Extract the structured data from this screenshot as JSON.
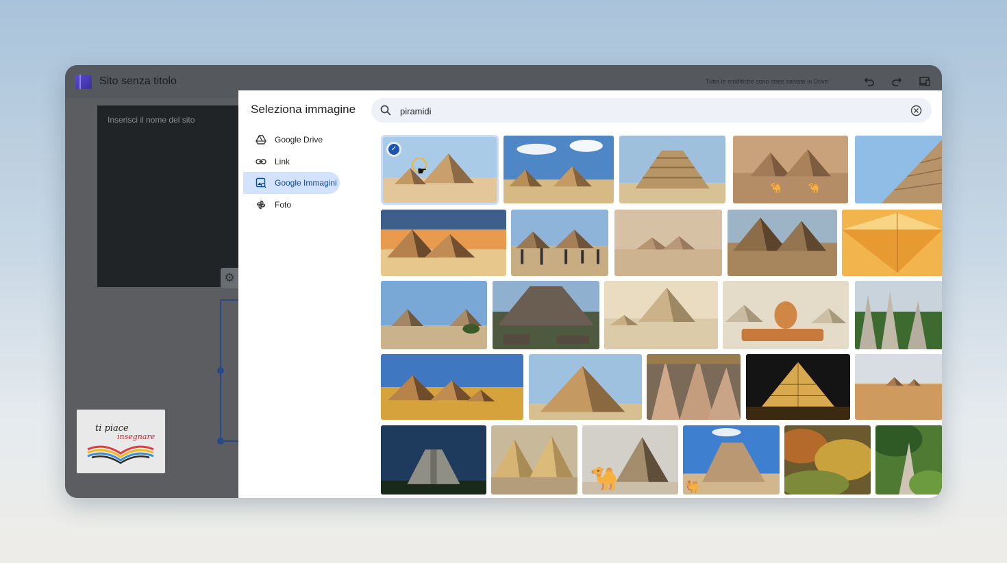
{
  "app": {
    "title": "Sito senza titolo",
    "saved_status": "Tutte le modifiche sono state salvate in Drive",
    "toolbar_icons": [
      "undo-icon",
      "redo-icon",
      "preview-devices-icon"
    ]
  },
  "editor": {
    "site_name_placeholder": "Inserisci il nome del sito",
    "gear_icon": "gear-icon"
  },
  "logo": {
    "line1": "ti piace",
    "line2": "insegnare"
  },
  "dialog": {
    "title": "Seleziona immagine",
    "search": {
      "value": "piramidi",
      "icon": "search-icon",
      "clear_icon": "clear-icon"
    },
    "sources": [
      {
        "label": "Google Drive",
        "icon": "drive-icon",
        "active": false
      },
      {
        "label": "Link",
        "icon": "link-icon",
        "active": false
      },
      {
        "label": "Google Immagini",
        "icon": "image-search-icon",
        "active": true
      },
      {
        "label": "Foto",
        "icon": "photos-icon",
        "active": false
      }
    ],
    "selected_image_index": 0
  },
  "colors": {
    "accent": "#1a56b4",
    "active_source_bg": "#d3e3fd",
    "active_source_text": "#0b4a9e",
    "overlay": "#5b5d61"
  }
}
